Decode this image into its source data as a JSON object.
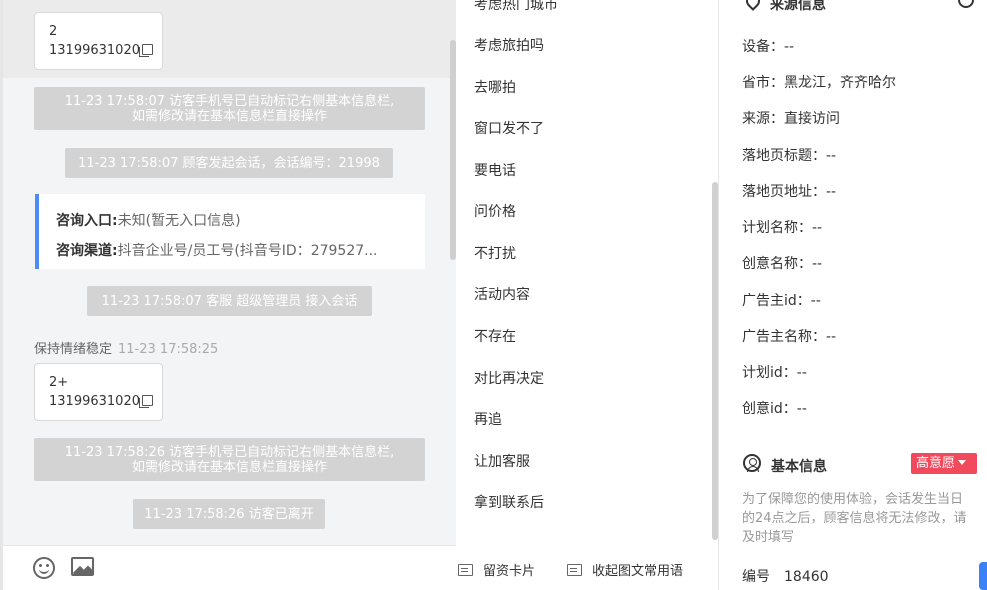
{
  "chat": {
    "card1": {
      "line1": "2",
      "line2": "13199631020"
    },
    "sys1": {
      "line1": "11-23 17:58:07 访客手机号已自动标记右侧基本信息栏,",
      "line2": "如需修改请在基本信息栏直接操作"
    },
    "sys2": "11-23 17:58:07 顾客发起会话，会话编号：21998",
    "consult": {
      "entry_label": "咨询入口:",
      "entry_value": "未知(暂无入口信息)",
      "channel_label": "咨询渠道:",
      "channel_value": "抖音企业号/员工号(抖音号ID：279527..."
    },
    "sys3": "11-23 17:58:07 客服 超级管理员 接入会话",
    "agent": {
      "name": "保持情绪稳定",
      "time": "11-23 17:58:25"
    },
    "card2": {
      "line1": "2+",
      "line2": "13199631020"
    },
    "sys4": {
      "line1": "11-23 17:58:26 访客手机号已自动标记右侧基本信息栏,",
      "line2": "如需修改请在基本信息栏直接操作"
    },
    "sys5": "11-23 17:58:26 访客已离开",
    "footer": {
      "emoji_icon": "emoji-icon",
      "image_icon": "image-icon"
    }
  },
  "quick_replies": {
    "items": [
      "考虑热门城市",
      "考虑旅拍吗",
      "去哪拍",
      "窗口发不了",
      "要电话",
      "问价格",
      "不打扰",
      "活动内容",
      "不存在",
      "对比再决定",
      "再追",
      "让加客服",
      "拿到联系后"
    ],
    "footer": {
      "card_label": "留资卡片",
      "collapse_label": "收起图文常用语"
    }
  },
  "source_info": {
    "title": "来源信息",
    "fields": [
      "设备：--",
      "省市：黑龙江，齐齐哈尔",
      "来源：直接访问",
      "落地页标题：--",
      "落地页地址：--",
      "计划名称：--",
      "创意名称：--",
      "广告主id：--",
      "广告主名称：--",
      "计划id：--",
      "创意id：--"
    ]
  },
  "basic_info": {
    "title": "基本信息",
    "intent_badge": "高意愿",
    "intent_color": "#f04a5c",
    "notice": "为了保障您的使用体验，会话发生当日的24点之后，顾客信息将无法修改，请及时填写",
    "number_label": "编号",
    "number_value": "18460"
  }
}
